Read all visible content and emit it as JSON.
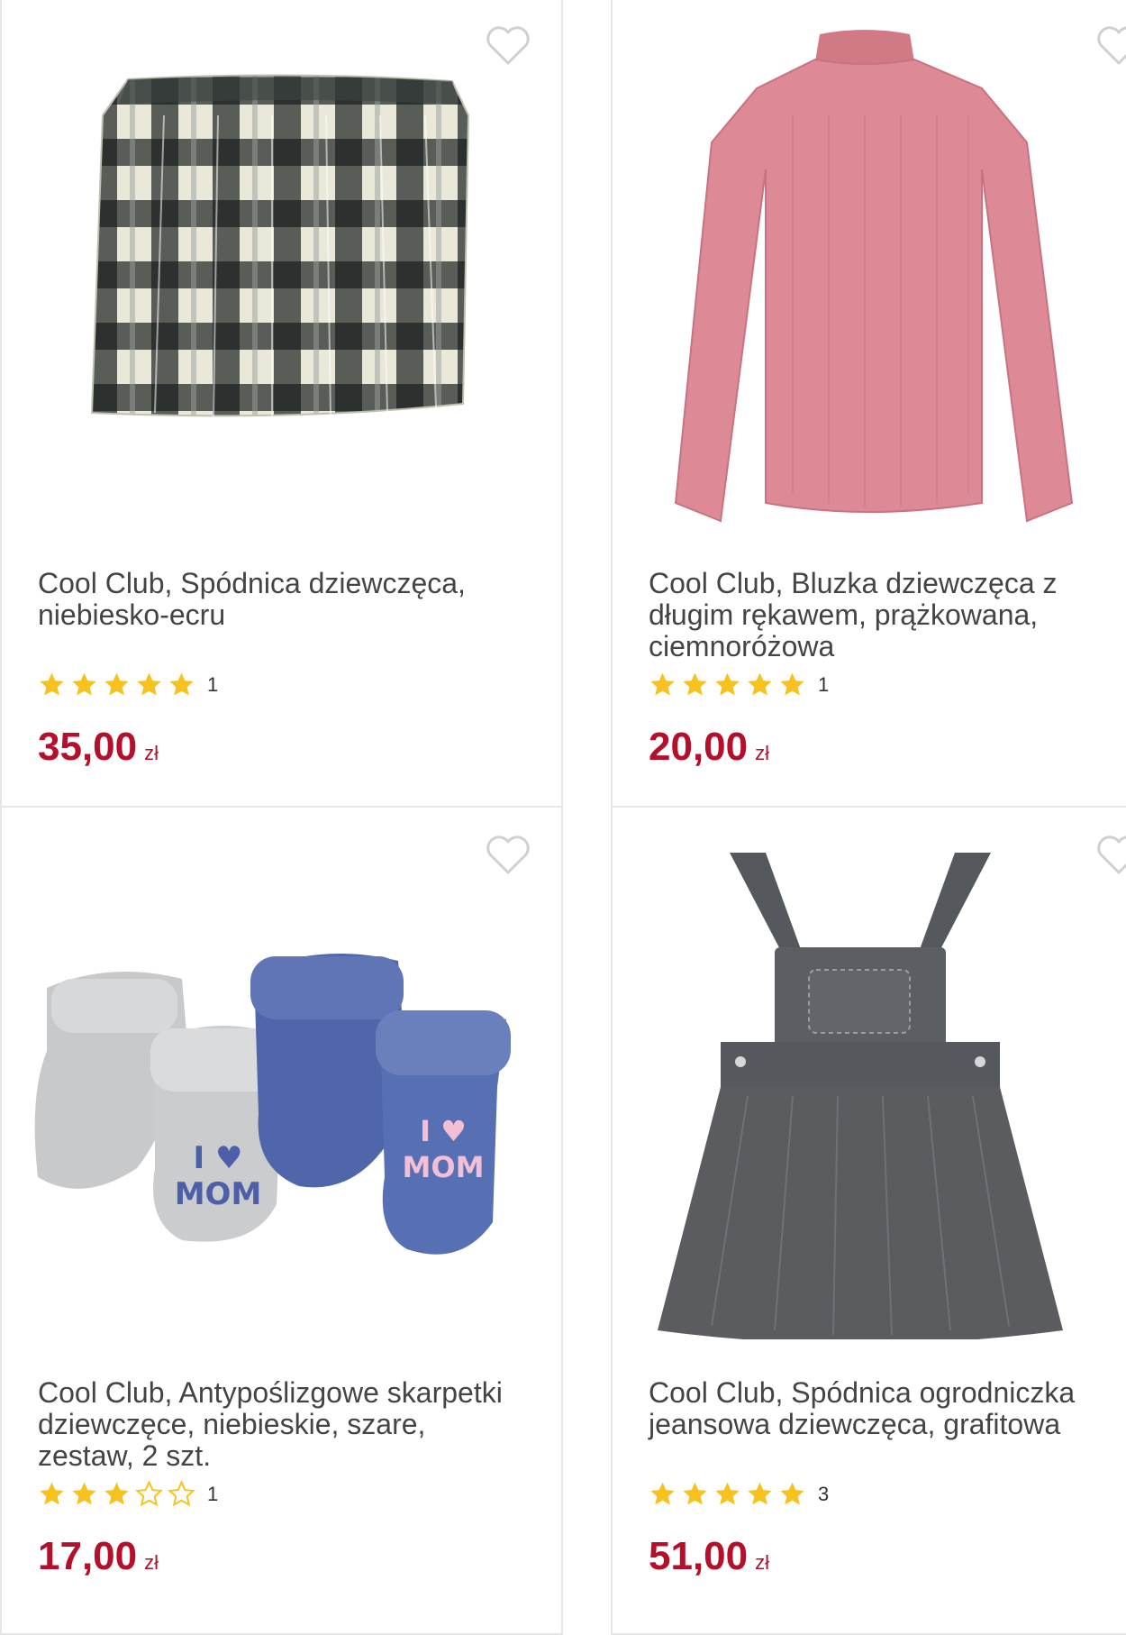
{
  "products": [
    {
      "title": "Cool Club, Spódnica dziewczęca, niebiesko-ecru",
      "rating": 5,
      "reviews": "1",
      "price": "35,00",
      "currency": "zł",
      "image": "plaid-skirt"
    },
    {
      "title": "Cool Club, Bluzka dziewczęca z długim rękawem, prążkowana, ciemnoróżowa",
      "rating": 5,
      "reviews": "1",
      "price": "20,00",
      "currency": "zł",
      "image": "pink-sweater"
    },
    {
      "title": "Cool Club, Antypoślizgowe skarpetki dziewczęce, niebieskie, szare, zestaw, 2 szt.",
      "rating": 3,
      "reviews": "1",
      "price": "17,00",
      "currency": "zł",
      "image": "baby-socks"
    },
    {
      "title": "Cool Club, Spódnica ogrodniczka jeansowa dziewczęca, grafitowa",
      "rating": 5,
      "reviews": "3",
      "price": "51,00",
      "currency": "zł",
      "image": "denim-pinafore"
    }
  ],
  "colors": {
    "price": "#b5102b",
    "star": "#f7c21e",
    "border": "#e6e6e6"
  }
}
